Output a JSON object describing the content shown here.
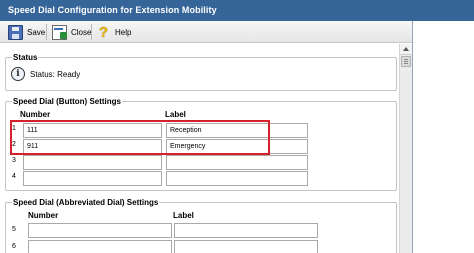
{
  "window": {
    "title": "Speed Dial Configuration for Extension Mobility"
  },
  "toolbar": {
    "save_label": "Save",
    "close_label": "Close",
    "help_label": "Help",
    "icons": [
      "floppy-disk-icon",
      "close-window-icon",
      "help-icon"
    ]
  },
  "status": {
    "legend": "Status",
    "text": "Status: Ready",
    "icon": "info-icon"
  },
  "button_dials": {
    "legend": "Speed Dial (Button) Settings",
    "col_number": "Number",
    "col_label": "Label",
    "rows": [
      {
        "index": "1",
        "number": "111",
        "label": "Reception"
      },
      {
        "index": "2",
        "number": "911",
        "label": "Emergency"
      },
      {
        "index": "3",
        "number": "",
        "label": ""
      },
      {
        "index": "4",
        "number": "",
        "label": ""
      }
    ],
    "highlight_color": "#d6202a"
  },
  "abbrev_dials": {
    "legend": "Speed Dial (Abbreviated Dial) Settings",
    "col_number": "Number",
    "col_label": "Label",
    "rows": [
      {
        "index": "5",
        "number": "",
        "label": ""
      },
      {
        "index": "6",
        "number": "",
        "label": ""
      }
    ]
  },
  "colors": {
    "titlebar": "#36659a",
    "highlight": "#d6202a"
  }
}
